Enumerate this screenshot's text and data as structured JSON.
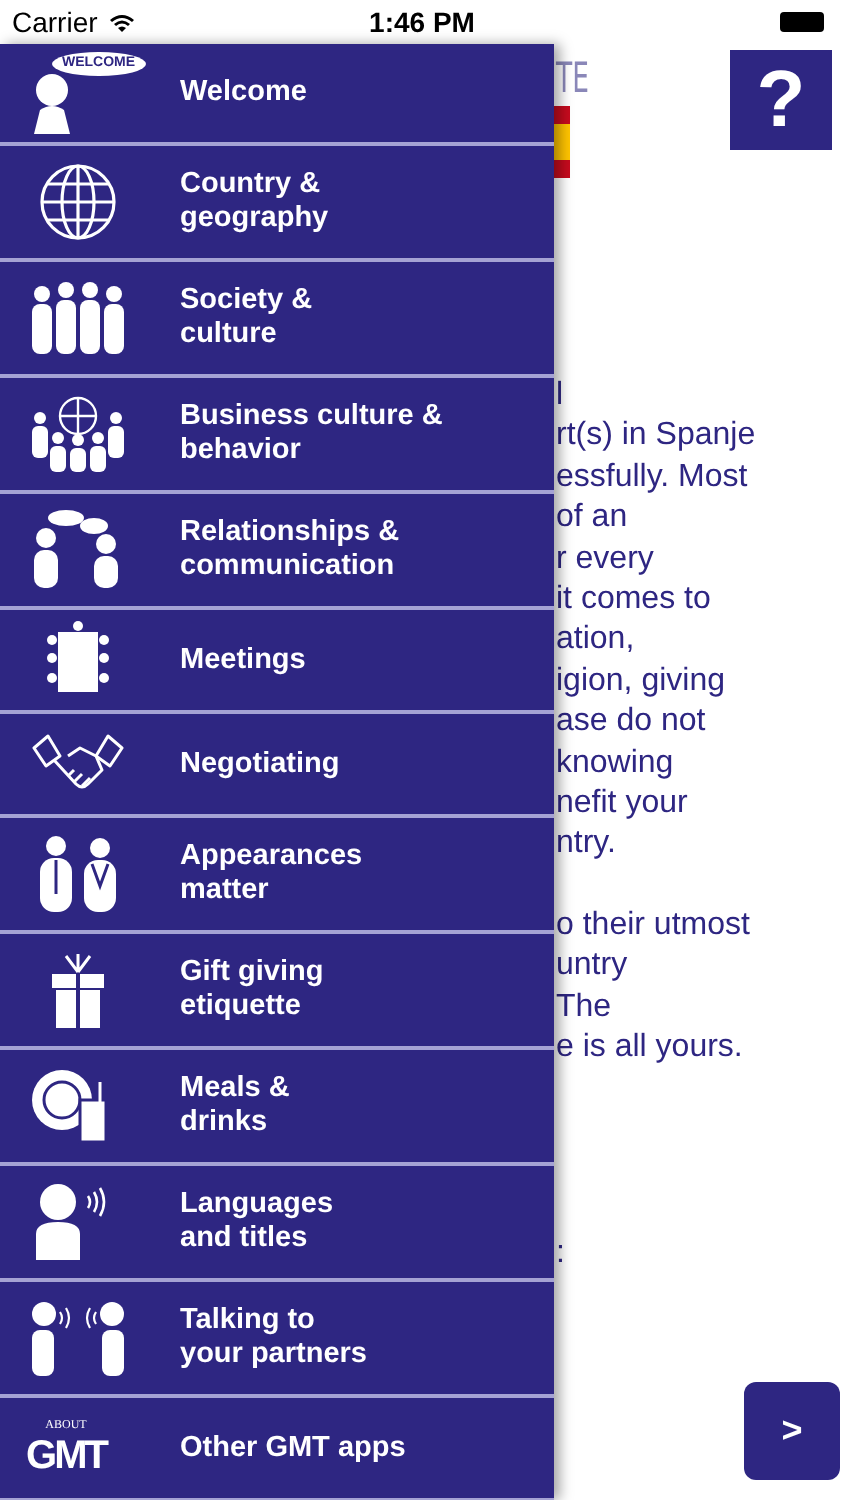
{
  "status_bar": {
    "carrier": "Carrier",
    "time": "1:46 PM"
  },
  "drawer": {
    "items": [
      {
        "label": "Welcome",
        "icon_label": "WELCOME"
      },
      {
        "label": "Country &\ngeography"
      },
      {
        "label": "Society &\nculture"
      },
      {
        "label": "Business culture &\nbehavior"
      },
      {
        "label": "Relationships &\ncommunication"
      },
      {
        "label": "Meetings"
      },
      {
        "label": "Negotiating"
      },
      {
        "label": "Appearances\nmatter"
      },
      {
        "label": "Gift giving\netiquette"
      },
      {
        "label": "Meals &\ndrinks"
      },
      {
        "label": "Languages\nand titles"
      },
      {
        "label": "Talking to\nyour partners"
      },
      {
        "label": "Other GMT apps",
        "icon_caption": "ABOUT",
        "icon_label": "GMT"
      }
    ]
  },
  "content": {
    "heading": "TE",
    "help_button": "?",
    "paragraphs": [
      [
        "l",
        "rt(s) in Spanje",
        "essfully. Most",
        "of an",
        "r every",
        "it comes to",
        "ation,",
        "igion, giving",
        "ase do not",
        "knowing",
        "nefit your",
        "ntry."
      ],
      [
        "o their utmost",
        "untry",
        "The",
        "e is all yours."
      ],
      [
        ":"
      ]
    ],
    "next_button": ">"
  }
}
